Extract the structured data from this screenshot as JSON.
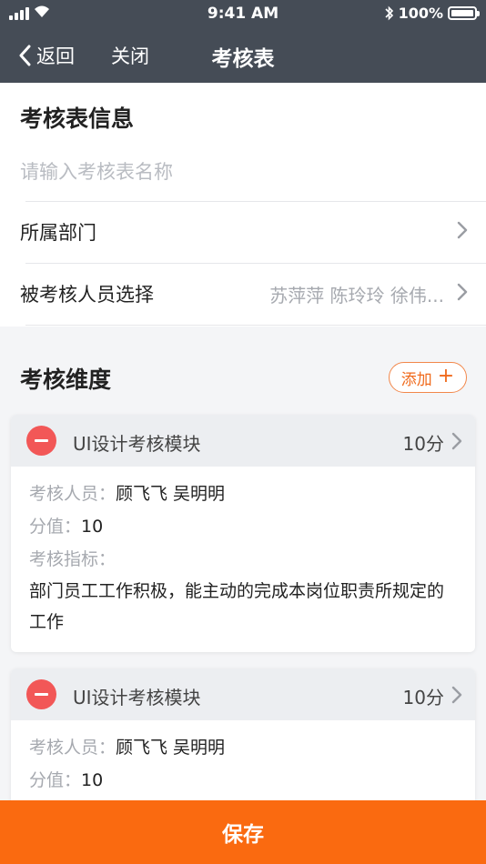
{
  "status_bar": {
    "time": "9:41 AM",
    "battery": "100%"
  },
  "nav": {
    "back_label": "返回",
    "close_label": "关闭",
    "title": "考核表"
  },
  "form": {
    "section_title": "考核表信息",
    "name_placeholder": "请输入考核表名称",
    "name_value": "",
    "department_label": "所属部门",
    "department_value": "",
    "assessees_label": "被考核人员选择",
    "assessees_value": "苏萍萍 陈玲玲 徐伟..."
  },
  "dimensions": {
    "title": "考核维度",
    "add_label": "添加",
    "items": [
      {
        "name": "UI设计考核模块",
        "score": "10分",
        "assessor_key": "考核人员：",
        "assessor_value": "顾飞飞 吴明明",
        "value_key": "分值：",
        "value_value": "10",
        "indicator_key": "考核指标：",
        "indicator_text": "部门员工工作积极，能主动的完成本岗位职责所规定的工作"
      },
      {
        "name": "UI设计考核模块",
        "score": "10分",
        "assessor_key": "考核人员：",
        "assessor_value": "顾飞飞 吴明明",
        "value_key": "分值：",
        "value_value": "10"
      }
    ]
  },
  "save_label": "保存",
  "colors": {
    "header": "#454c56",
    "accent": "#fa6a10",
    "danger": "#f25757"
  }
}
